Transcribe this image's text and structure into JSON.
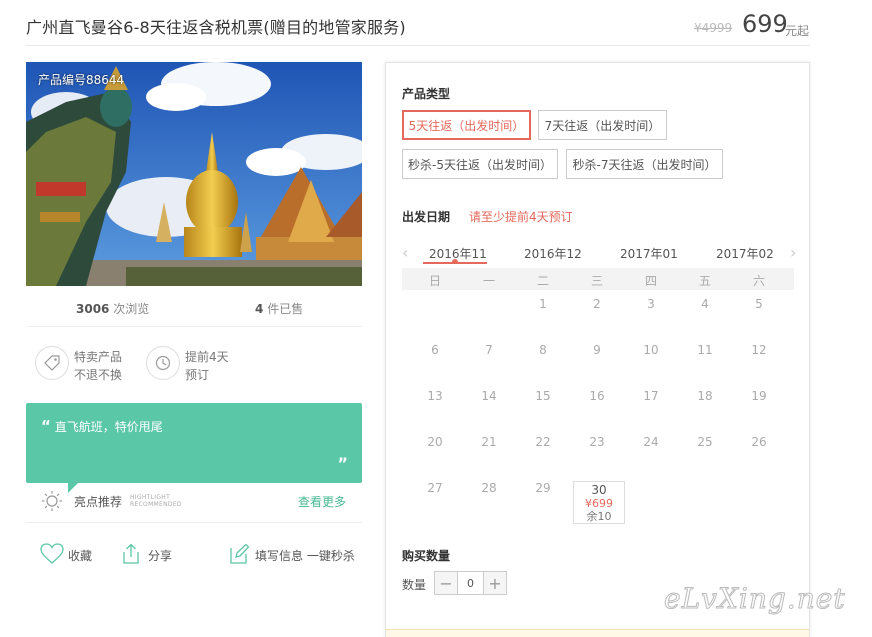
{
  "header": {
    "title": "广州直飞曼谷6-8天往返含税机票(赠目的地管家服务)",
    "price_old": "¥4999",
    "price": "699",
    "price_unit": "元起"
  },
  "photo": {
    "code": "产品编号88644"
  },
  "stats": {
    "views_num": "3006",
    "views_label": "次浏览",
    "sold_num": "4",
    "sold_label": "件已售"
  },
  "features": [
    {
      "line1": "特卖产品",
      "line2": "不退不换"
    },
    {
      "line1": "提前4天",
      "line2": "预订"
    }
  ],
  "quote": {
    "text": "直飞航班，特价甩尾",
    "close": "”"
  },
  "highlight": {
    "label": "亮点推荐",
    "en1": "HIGHTLIGHT",
    "en2": "RECOMMENDED",
    "more": "查看更多"
  },
  "actions": {
    "favorite": "收藏",
    "share": "分享",
    "fill": "填写信息 一键秒杀"
  },
  "product_type": {
    "title": "产品类型",
    "options": [
      "5天往返（出发时间）",
      "7天往返（出发时间）",
      "秒杀-5天往返（出发时间）",
      "秒杀-7天往返（出发时间）"
    ]
  },
  "depart": {
    "title": "出发日期",
    "note": "请至少提前4天预订",
    "months": [
      "2016年11",
      "2016年12",
      "2017年01",
      "2017年02"
    ],
    "weekdays": [
      "日",
      "一",
      "二",
      "三",
      "四",
      "五",
      "六"
    ],
    "days": [
      "1",
      "2",
      "3",
      "4",
      "5",
      "6",
      "7",
      "8",
      "9",
      "10",
      "11",
      "12",
      "13",
      "14",
      "15",
      "16",
      "17",
      "18",
      "19",
      "20",
      "21",
      "22",
      "23",
      "24",
      "25",
      "26",
      "27",
      "28",
      "29"
    ],
    "available": {
      "day": "30",
      "price": "¥699",
      "remain": "余10"
    }
  },
  "quantity": {
    "title": "购买数量",
    "label": "数量",
    "minus": "−",
    "value": "0",
    "plus": "+"
  },
  "watermark": "eLvXing.net",
  "colors": {
    "accent": "#e5695b",
    "green": "#5ac7a7"
  }
}
